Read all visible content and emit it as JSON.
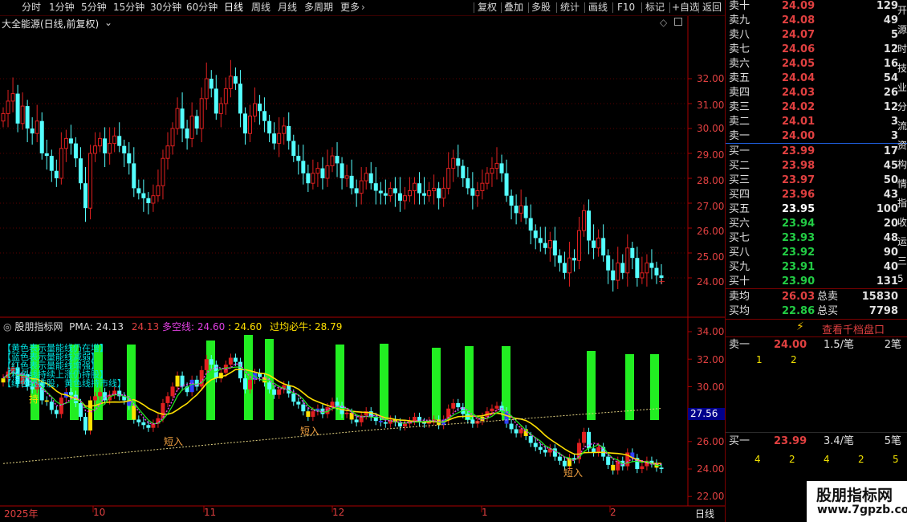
{
  "toolbar": {
    "left": [
      "分时",
      "1分钟",
      "5分钟",
      "15分钟",
      "30分钟",
      "60分钟",
      "日线",
      "周线",
      "月线",
      "多周期",
      "更多"
    ],
    "active": "日线",
    "right": [
      "复权",
      "叠加",
      "多股",
      "统计",
      "画线",
      "F10",
      "标记",
      "+自选",
      "返回"
    ]
  },
  "icons": {
    "more": "chevron-right-icon",
    "diamond": "diamond-icon",
    "square": "square-icon",
    "flash": "lightning-icon",
    "radio": "radio-icon"
  },
  "main_chart": {
    "title": "大全能源(日线,前复权)",
    "y_ticks": [
      "32.00",
      "31.00",
      "30.00",
      "29.00",
      "28.00",
      "27.00",
      "26.00",
      "25.00",
      "24.00"
    ]
  },
  "indicator": {
    "name": "股朋指标网",
    "pma_label": "PMA:",
    "pma_value": "24.13",
    "value2": "24.13",
    "dk_label": "多空线:",
    "dk_value": "24.60",
    "value3": ": 24.60",
    "gj_label": "过均必牛:",
    "gj_value": "28.79",
    "y_ticks": [
      "34.00",
      "32.00",
      "30.00",
      "28.00",
      "26.00",
      "24.00",
      "22.00"
    ],
    "marker_value": "27.56",
    "short_entry": "短入",
    "legend": [
      "【黄色表示量能线仍在增】",
      "【蓝色表示量能线减弱】",
      "【红色表示量能线增强】",
      "【粉色线持续上涨仍持股】",
      "【绿色线持股，黄色线持市线】"
    ],
    "legend_char": "持"
  },
  "time_axis": {
    "labels": [
      "2025年",
      "10",
      "11",
      "12",
      "1",
      "2"
    ],
    "period": "日线"
  },
  "orderbook": {
    "asks": [
      {
        "label": "卖十",
        "price": "24.09",
        "vol": "129"
      },
      {
        "label": "卖九",
        "price": "24.08",
        "vol": "49"
      },
      {
        "label": "卖八",
        "price": "24.07",
        "vol": "5"
      },
      {
        "label": "卖七",
        "price": "24.06",
        "vol": "12"
      },
      {
        "label": "卖六",
        "price": "24.05",
        "vol": "16"
      },
      {
        "label": "卖五",
        "price": "24.04",
        "vol": "54"
      },
      {
        "label": "卖四",
        "price": "24.03",
        "vol": "26"
      },
      {
        "label": "卖三",
        "price": "24.02",
        "vol": "12"
      },
      {
        "label": "卖二",
        "price": "24.01",
        "vol": "3"
      },
      {
        "label": "卖一",
        "price": "24.00",
        "vol": "3"
      }
    ],
    "bids": [
      {
        "label": "买一",
        "price": "23.99",
        "vol": "17",
        "color": "#e04040"
      },
      {
        "label": "买二",
        "price": "23.98",
        "vol": "45",
        "color": "#e04040"
      },
      {
        "label": "买三",
        "price": "23.97",
        "vol": "50",
        "color": "#e04040"
      },
      {
        "label": "买四",
        "price": "23.96",
        "vol": "43",
        "color": "#e04040"
      },
      {
        "label": "买五",
        "price": "23.95",
        "vol": "100",
        "color": "#ffffff"
      },
      {
        "label": "买六",
        "price": "23.94",
        "vol": "20",
        "color": "#22cc44"
      },
      {
        "label": "买七",
        "price": "23.93",
        "vol": "48",
        "color": "#22cc44"
      },
      {
        "label": "买八",
        "price": "23.92",
        "vol": "90",
        "color": "#22cc44"
      },
      {
        "label": "买九",
        "price": "23.91",
        "vol": "40",
        "color": "#22cc44"
      },
      {
        "label": "买十",
        "price": "23.90",
        "vol": "131",
        "color": "#22cc44"
      }
    ],
    "avg_ask": {
      "label": "卖均",
      "price": "26.03",
      "total_label": "总卖",
      "total": "15830"
    },
    "avg_bid": {
      "label": "买均",
      "price": "22.86",
      "total_label": "总买",
      "total": "7798"
    },
    "thousand_button": "查看千档盘口",
    "sell1": {
      "label": "卖一",
      "price": "24.00",
      "vol": "1.5/笔",
      "count": "2笔",
      "detail": [
        "1",
        "2"
      ]
    },
    "buy1": {
      "label": "买一",
      "price": "23.99",
      "vol": "3.4/笔",
      "count": "5笔",
      "detail": [
        "4",
        "2",
        "4",
        "2",
        "5"
      ]
    }
  },
  "side_strip": [
    "开",
    "源",
    "时",
    "技",
    "业",
    "分",
    "流",
    "资",
    "构",
    "情",
    "指",
    "收",
    "运",
    "三",
    "5"
  ],
  "watermark": {
    "title": "股朋指标网",
    "url": "www.7gpzb.com"
  },
  "colors": {
    "up": "#e02020",
    "down": "#54ffff",
    "grid": "#5a0000",
    "green_bar": "#22ee22",
    "yellow": "#ffe000",
    "magenta": "#e040e0"
  }
}
